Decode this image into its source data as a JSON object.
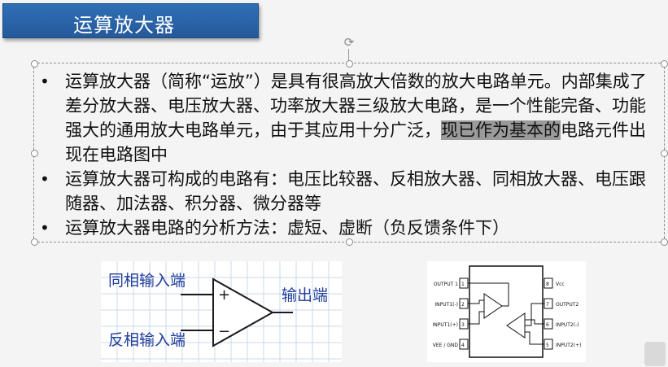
{
  "title": "运算放大器",
  "bullets": [
    {
      "pre": "运算放大器（简称“运放”）是具有很高放大倍数的放大电路单元。内部集成了差分放大器、电压放大器、功率放大器三级放大电路，是一个性能完备、功能强大的通用放大电路单元，由于其应用十分广泛，",
      "highlight": "现已作为基本的",
      "post": "电路元件出现在电路图中"
    },
    {
      "text": "运算放大器可构成的电路有：电压比较器、反相放大器、同相放大器、电压跟随器、加法器、积分器、微分器等"
    },
    {
      "text": "运算放大器电路的分析方法：虚短、虚断（负反馈条件下）"
    }
  ],
  "opamp_diagram": {
    "noninverting_label": "同相输入端",
    "inverting_label": "反相输入端",
    "output_label": "输出端",
    "plus_sign": "+",
    "minus_sign": "−"
  },
  "ic_diagram": {
    "left_pins": [
      {
        "num": "1",
        "label": "OUTPUT 1"
      },
      {
        "num": "2",
        "label": "INPUT1(-)"
      },
      {
        "num": "3",
        "label": "INPUT1(+)"
      },
      {
        "num": "4",
        "label": "VEE / GND"
      }
    ],
    "right_pins": [
      {
        "num": "8",
        "label": "Vcc"
      },
      {
        "num": "7",
        "label": "OUTPUT2"
      },
      {
        "num": "6",
        "label": "INPUT2(-)"
      },
      {
        "num": "5",
        "label": "INPUT2(+)"
      }
    ]
  }
}
